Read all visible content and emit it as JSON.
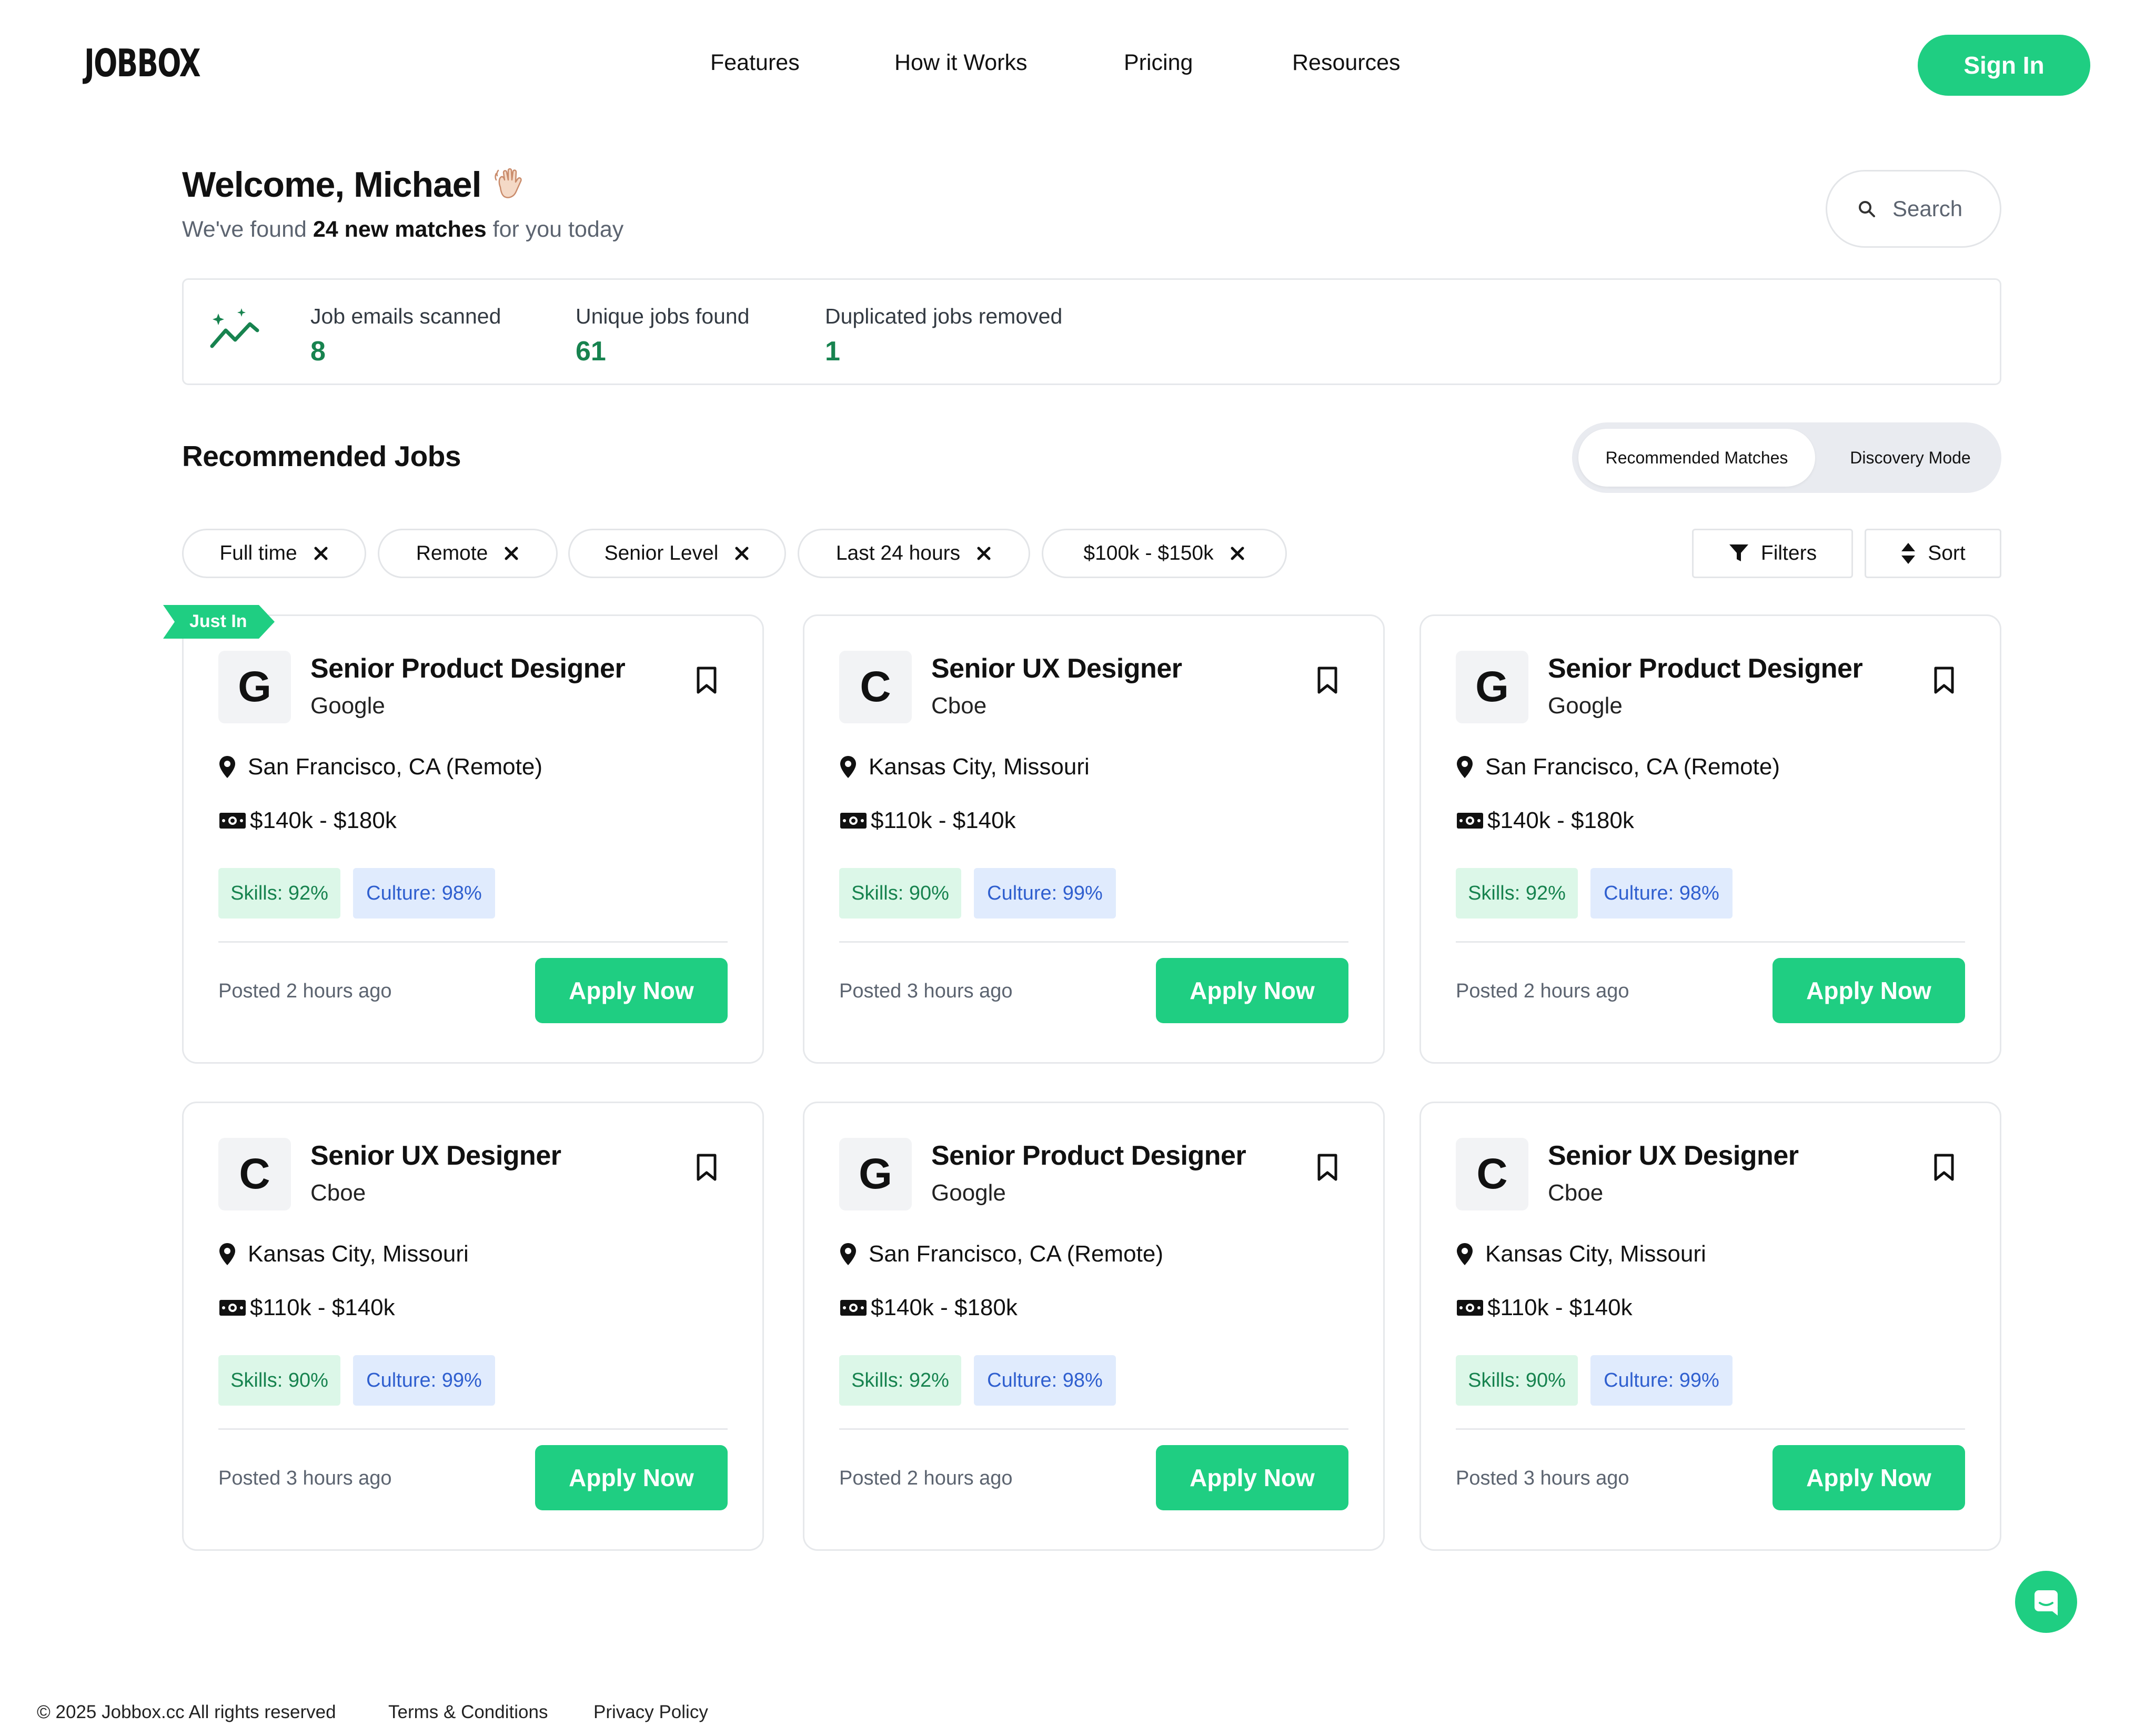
{
  "brand": {
    "logo": "JOBBOX",
    "accent": "#1fce82",
    "accent_dark": "#17834f"
  },
  "nav": {
    "links": [
      "Features",
      "How it Works",
      "Pricing",
      "Resources"
    ],
    "sign_in": "Sign In"
  },
  "welcome": {
    "title": "Welcome, Michael",
    "emoji": "waving-hand",
    "subtitle_pre": "We've found ",
    "subtitle_bold": "24 new matches",
    "subtitle_post": " for you today"
  },
  "search": {
    "label": "Search",
    "icon": "search-icon"
  },
  "stats": {
    "icon": "sparkle-trend-icon",
    "items": [
      {
        "label": "Job emails scanned",
        "value": "8"
      },
      {
        "label": "Unique jobs found",
        "value": "61"
      },
      {
        "label": "Duplicated jobs removed",
        "value": "1"
      }
    ]
  },
  "recommended": {
    "title": "Recommended Jobs",
    "modes": {
      "active": "Recommended Matches",
      "other": "Discovery Mode"
    }
  },
  "filters": {
    "chips": [
      "Full time",
      "Remote",
      "Senior Level",
      "Last 24 hours",
      "$100k - $150k"
    ],
    "filters_button": "Filters",
    "sort_button": "Sort"
  },
  "badge": {
    "just_in": "Just In"
  },
  "jobs": [
    {
      "logo": "G",
      "title": "Senior Product Designer",
      "company": "Google",
      "location": "San Francisco, CA (Remote)",
      "salary": "$140k - $180k",
      "skills": "Skills: 92%",
      "culture": "Culture: 98%",
      "posted": "Posted 2 hours ago",
      "apply": "Apply Now"
    },
    {
      "logo": "C",
      "title": "Senior UX Designer",
      "company": "Cboe",
      "location": "Kansas City, Missouri",
      "salary": "$110k - $140k",
      "skills": "Skills: 90%",
      "culture": "Culture: 99%",
      "posted": "Posted 3 hours ago",
      "apply": "Apply Now"
    },
    {
      "logo": "G",
      "title": "Senior Product Designer",
      "company": "Google",
      "location": "San Francisco, CA (Remote)",
      "salary": "$140k - $180k",
      "skills": "Skills: 92%",
      "culture": "Culture: 98%",
      "posted": "Posted 2 hours ago",
      "apply": "Apply Now"
    },
    {
      "logo": "C",
      "title": "Senior UX Designer",
      "company": "Cboe",
      "location": "Kansas City, Missouri",
      "salary": "$110k - $140k",
      "skills": "Skills: 90%",
      "culture": "Culture: 99%",
      "posted": "Posted 3 hours ago",
      "apply": "Apply Now"
    },
    {
      "logo": "G",
      "title": "Senior Product Designer",
      "company": "Google",
      "location": "San Francisco, CA (Remote)",
      "salary": "$140k - $180k",
      "skills": "Skills: 92%",
      "culture": "Culture: 98%",
      "posted": "Posted 2 hours ago",
      "apply": "Apply Now"
    },
    {
      "logo": "C",
      "title": "Senior UX Designer",
      "company": "Cboe",
      "location": "Kansas City, Missouri",
      "salary": "$110k - $140k",
      "skills": "Skills: 90%",
      "culture": "Culture: 99%",
      "posted": "Posted 3 hours ago",
      "apply": "Apply Now"
    }
  ],
  "footer": {
    "copyright": "© 2025 Jobbox.cc All rights reserved",
    "terms": "Terms & Conditions",
    "privacy": "Privacy Policy"
  }
}
